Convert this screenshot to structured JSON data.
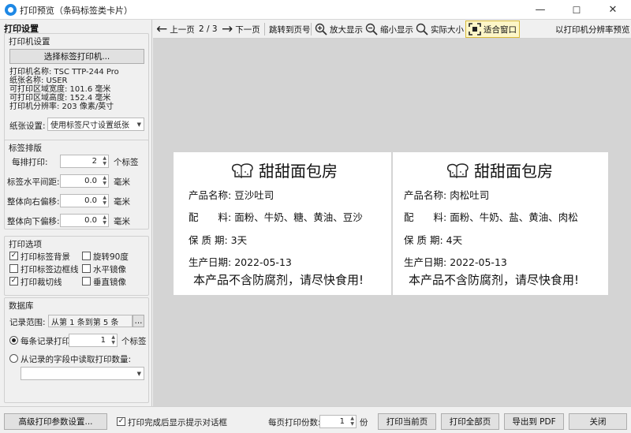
{
  "window": {
    "title": "打印预览（条码标签类卡片）",
    "controls": [
      "—",
      "☐",
      "✕"
    ]
  },
  "left": {
    "header": "打印设置",
    "printer": {
      "title": "打印机设置",
      "select_button": "选择标签打印机...",
      "info": [
        "打印机名称: TSC TTP-244 Pro",
        "纸张名称: USER",
        "可打印区域宽度: 101.6 毫米",
        "可打印区域高度: 152.4 毫米",
        "打印机分辨率: 203 像素/英寸"
      ],
      "paper_label": "纸张设置:",
      "paper_value": "使用标签尺寸设置纸张"
    },
    "layout": {
      "title": "标签排版",
      "fields": [
        {
          "label": "每排打印:",
          "value": "2",
          "unit": "个标签"
        },
        {
          "label": "标签水平间距:",
          "value": "0.0",
          "unit": "毫米"
        },
        {
          "label": "整体向右偏移:",
          "value": "0.0",
          "unit": "毫米"
        },
        {
          "label": "整体向下偏移:",
          "value": "0.0",
          "unit": "毫米"
        }
      ]
    },
    "options": {
      "title": "打印选项",
      "items": [
        {
          "label": "打印标签背景",
          "checked": true
        },
        {
          "label": "旋转90度",
          "checked": false
        },
        {
          "label": "打印标签边框线",
          "checked": false
        },
        {
          "label": "水平镜像",
          "checked": false
        },
        {
          "label": "打印裁切线",
          "checked": true
        },
        {
          "label": "垂直镜像",
          "checked": false
        }
      ]
    },
    "database": {
      "title": "数据库",
      "range_label": "记录范围:",
      "range_value": "从第 1 条到第 5 条",
      "browse": "...",
      "per_record_label": "每条记录打印",
      "per_record_value": "1",
      "per_record_unit": "个标签",
      "from_field_label": "从记录的字段中读取打印数量:",
      "from_field_value": ""
    }
  },
  "toolbar": {
    "prev": "上一页",
    "page": "2 / 3",
    "next": "下一页",
    "goto": "跳转到页号",
    "zoom_in": "放大显示",
    "zoom_out": "缩小显示",
    "actual": "实际大小",
    "fit": "适合窗口",
    "resolution": "以打印机分辨率预览"
  },
  "labels": [
    {
      "shop": "甜甜面包房",
      "name_key": "产品名称:",
      "name_value": "豆沙吐司",
      "ingredients_key": "配　　料:",
      "ingredients_value": "面粉、牛奶、糖、黄油、豆沙",
      "shelf_key": "保 质 期:",
      "shelf_value": "3天",
      "date_key": "生产日期:",
      "date_value": "2022-05-13",
      "notice": "本产品不含防腐剂，请尽快食用!"
    },
    {
      "shop": "甜甜面包房",
      "name_key": "产品名称:",
      "name_value": "肉松吐司",
      "ingredients_key": "配　　料:",
      "ingredients_value": "面粉、牛奶、盐、黄油、肉松",
      "shelf_key": "保 质 期:",
      "shelf_value": "4天",
      "date_key": "生产日期:",
      "date_value": "2022-05-13",
      "notice": "本产品不含防腐剂，请尽快食用!"
    }
  ],
  "bottom": {
    "advanced": "高级打印参数设置...",
    "show_dialog": "打印完成后显示提示对话框",
    "show_dialog_checked": true,
    "copies_label": "每页打印份数:",
    "copies_value": "1",
    "copies_unit": "份",
    "print_current": "打印当前页",
    "print_all": "打印全部页",
    "export_pdf": "导出到 PDF",
    "close": "关闭"
  }
}
